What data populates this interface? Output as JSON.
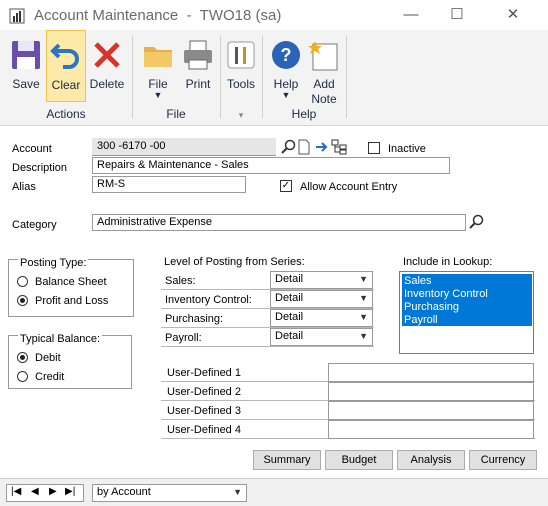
{
  "window": {
    "title": "Account Maintenance  -  TWO18 (sa)",
    "controls": {
      "minimize": "—",
      "maximize": "☐",
      "close": "✕"
    }
  },
  "ribbon": {
    "save": "Save",
    "clear": "Clear",
    "delete": "Delete",
    "actions_group": "Actions",
    "file": "File",
    "print": "Print",
    "file_group": "File",
    "tools": "Tools",
    "help": "Help",
    "add_note_1": "Add",
    "add_note_2": "Note",
    "help_group": "Help"
  },
  "form": {
    "account_label": "Account",
    "account_value": "300 -6170 -00",
    "inactive_label": "Inactive",
    "description_label": "Description",
    "description_value": "Repairs & Maintenance - Sales",
    "alias_label": "Alias",
    "alias_value": "RM-S",
    "allow_entry_label": "Allow Account Entry",
    "category_label": "Category",
    "category_value": "Administrative Expense",
    "posting_type_label": "Posting Type:",
    "balance_sheet": "Balance Sheet",
    "profit_loss": "Profit and Loss",
    "typical_balance_label": "Typical Balance:",
    "debit": "Debit",
    "credit": "Credit",
    "level_label": "Level of Posting from Series:",
    "series": [
      {
        "label": "Sales:",
        "value": "Detail"
      },
      {
        "label": "Inventory Control:",
        "value": "Detail"
      },
      {
        "label": "Purchasing:",
        "value": "Detail"
      },
      {
        "label": "Payroll:",
        "value": "Detail"
      }
    ],
    "lookup_label": "Include in Lookup:",
    "lookup_items": [
      "Sales",
      "Inventory Control",
      "Purchasing",
      "Payroll"
    ],
    "user_defined": [
      "User-Defined 1",
      "User-Defined 2",
      "User-Defined 3",
      "User-Defined 4"
    ],
    "summary": "Summary",
    "budget": "Budget",
    "analysis": "Analysis",
    "currency": "Currency"
  },
  "footer": {
    "sort_value": "by Account"
  },
  "colors": {
    "accent": "#0078d7",
    "selection": "#0078d7"
  },
  "state": {
    "inactive": false,
    "allow_account_entry": true,
    "posting_type": "Profit and Loss",
    "typical_balance": "Debit"
  }
}
